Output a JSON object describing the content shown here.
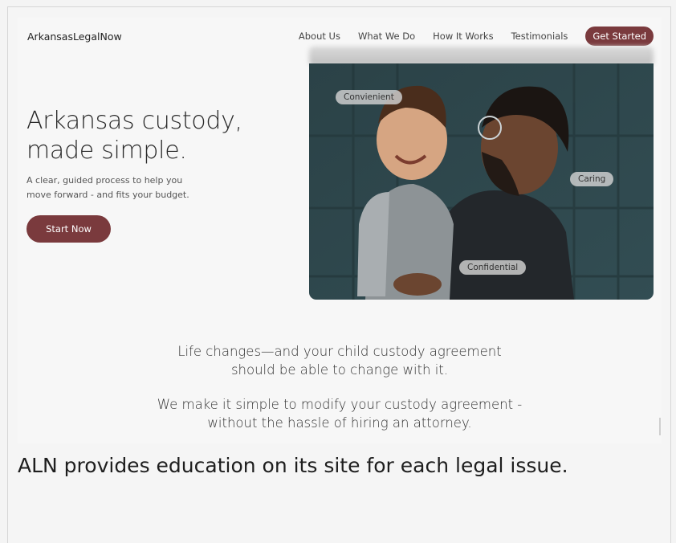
{
  "header": {
    "brand": "ArkansasLegalNow",
    "nav": [
      "About Us",
      "What We Do",
      "How It Works",
      "Testimonials"
    ],
    "cta": "Get Started"
  },
  "hero": {
    "title": "Arkansas custody, made simple.",
    "subtitle": "A clear, guided process to help you move forward - and fits your budget.",
    "button": "Start Now",
    "badges": [
      "Convienient",
      "Caring",
      "Confidential"
    ]
  },
  "intro": {
    "line1": "Life changes—and your child custody agreement should be able to change with it.",
    "line2": "We make it simple to modify your custody agreement - without the hassle of hiring an attorney."
  },
  "caption": "ALN provides education on its site for each legal issue.",
  "colors": {
    "accent": "#7a3a3d",
    "photo_bg": "#2f4a50"
  }
}
